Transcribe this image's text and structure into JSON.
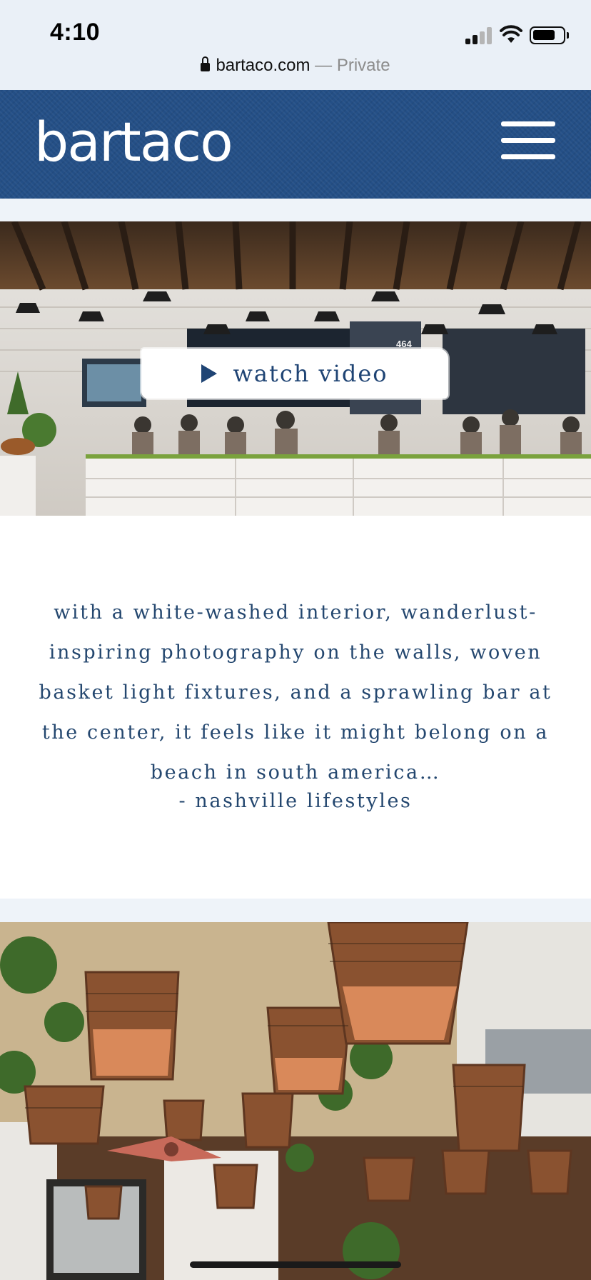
{
  "status": {
    "time": "4:10",
    "url": "bartaco.com",
    "private_label": "— Private"
  },
  "header": {
    "logo": "bartaco",
    "menu_icon": "hamburger-icon"
  },
  "hero": {
    "video_label": "watch video",
    "play_icon": "play-icon",
    "sign_number": "464"
  },
  "quote": {
    "lines": [
      "with a white-washed interior, wanderlust-",
      "inspiring photography on the walls, woven",
      "basket light fixtures, and a sprawling bar at",
      "the center, it feels like it might belong on a",
      "beach in south america…"
    ],
    "source": "- nashville lifestyles"
  },
  "colors": {
    "brand_blue": "#244f86",
    "text_blue": "#24476f",
    "page_bg": "#eef3f9"
  }
}
